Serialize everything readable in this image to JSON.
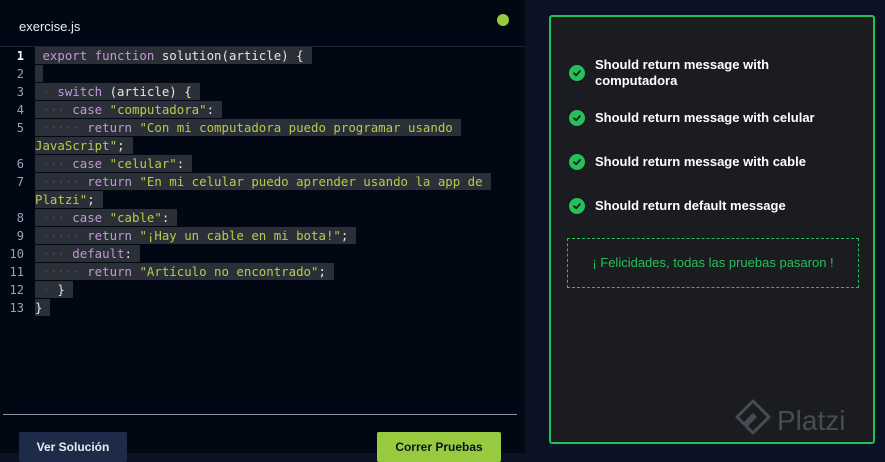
{
  "editor": {
    "tab_title": "exercise.js",
    "line_numbers": [
      "1",
      "2",
      "3",
      "4",
      "5",
      "6",
      "7",
      "8",
      "9",
      "10",
      "11",
      "12",
      "13"
    ],
    "buttons": {
      "solution_label": "Ver Solución",
      "run_label": "Correr Pruebas"
    }
  },
  "results": {
    "tests": [
      {
        "label": "Should return message with computadora",
        "status": "passed"
      },
      {
        "label": "Should return message with celular",
        "status": "passed"
      },
      {
        "label": "Should return message with cable",
        "status": "passed"
      },
      {
        "label": "Should return default message",
        "status": "passed"
      }
    ],
    "success_message": "¡ Felicidades, todas las pruebas pasaron !"
  },
  "watermark": {
    "text": "Platzi"
  },
  "colors": {
    "accent_green": "#98ca3f",
    "success_green": "#24c05a",
    "keyword": "#c397d8",
    "string": "#b9ca4a"
  }
}
